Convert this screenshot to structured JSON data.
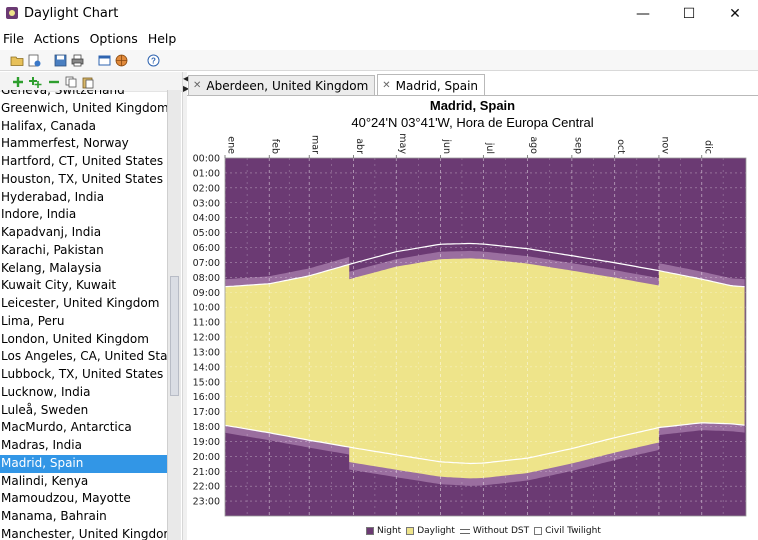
{
  "window": {
    "title": "Daylight Chart",
    "minimize_glyph": "—",
    "maximize_glyph": "☐",
    "close_glyph": "✕"
  },
  "menu": [
    "File",
    "Actions",
    "Options",
    "Help"
  ],
  "toolbar": {
    "icons": [
      "open-folder-icon",
      "open-recent-icon",
      "save-icon",
      "print-icon",
      "window-icon",
      "globe-icon",
      "help-icon"
    ]
  },
  "left_toolbar": {
    "icons": [
      "add-location-icon",
      "add-multiple-icon",
      "remove-location-icon",
      "copy-icon",
      "paste-icon"
    ]
  },
  "locations": [
    "Geneva, Switzerland",
    "Greenwich, United Kingdom",
    "Halifax, Canada",
    "Hammerfest, Norway",
    "Hartford, CT, United States",
    "Houston, TX, United States",
    "Hyderabad, India",
    "Indore, India",
    "Kapadvanj, India",
    "Karachi, Pakistan",
    "Kelang, Malaysia",
    "Kuwait City, Kuwait",
    "Leicester, United Kingdom",
    "Lima, Peru",
    "London, United Kingdom",
    "Los Angeles, CA, United States",
    "Lubbock, TX, United States",
    "Lucknow, India",
    "Luleå, Sweden",
    "MacMurdo, Antarctica",
    "Madras, India",
    "Madrid, Spain",
    "Malindi, Kenya",
    "Mamoudzou, Mayotte",
    "Manama, Bahrain",
    "Manchester, United Kingdom"
  ],
  "selected_location_index": 21,
  "tabs": [
    {
      "label": "Aberdeen, United Kingdom",
      "close_glyph": "✕",
      "active": false
    },
    {
      "label": "Madrid, Spain",
      "close_glyph": "✕",
      "active": true
    }
  ],
  "colors": {
    "night": "#6b3a73",
    "twilight": "#9a6e9f",
    "daylight": "#eee48a",
    "selection": "#3296e6"
  },
  "chart_data": {
    "type": "area",
    "title": "Madrid, Spain",
    "subtitle": "40°24'N 03°41'W, Hora de Europa Central",
    "x_labels": [
      "ene",
      "feb",
      "mar",
      "abr",
      "may",
      "jun",
      "jul",
      "ago",
      "sep",
      "oct",
      "nov",
      "dic"
    ],
    "y_labels": [
      "00:00",
      "01:00",
      "02:00",
      "03:00",
      "04:00",
      "05:00",
      "06:00",
      "07:00",
      "08:00",
      "09:00",
      "10:00",
      "11:00",
      "12:00",
      "13:00",
      "14:00",
      "15:00",
      "16:00",
      "17:00",
      "18:00",
      "19:00",
      "20:00",
      "21:00",
      "22:00",
      "23:00"
    ],
    "y_range": [
      0,
      24
    ],
    "x_range_days": [
      0,
      365
    ],
    "dst_period_days": [
      87,
      304
    ],
    "dst_shift_hours": 1,
    "series": [
      {
        "name": "Night",
        "type": "background"
      },
      {
        "name": "Daylight",
        "days": [
          0,
          31,
          59,
          90,
          120,
          151,
          172,
          181,
          212,
          243,
          273,
          304,
          334,
          355,
          365
        ],
        "sunrise_std": [
          8.63,
          8.43,
          7.9,
          7.05,
          6.28,
          5.78,
          5.73,
          5.77,
          6.08,
          6.55,
          7.02,
          7.55,
          8.12,
          8.57,
          8.63
        ],
        "sunset_std": [
          17.92,
          18.42,
          18.92,
          19.43,
          19.9,
          20.37,
          20.48,
          20.45,
          20.12,
          19.48,
          18.75,
          18.07,
          17.75,
          17.82,
          17.92
        ]
      },
      {
        "name": "Without DST",
        "type": "line"
      },
      {
        "name": "Civil Twilight",
        "offset_hours": 0.5
      }
    ],
    "legend": [
      {
        "label": "Night",
        "swatch": "#6b3a73"
      },
      {
        "label": "Daylight",
        "swatch": "#eee48a"
      },
      {
        "label": "Without DST",
        "swatch": "line"
      },
      {
        "label": "Civil Twilight",
        "swatch": "#ffffff"
      }
    ],
    "legend_position": "bottom",
    "grid": true
  }
}
